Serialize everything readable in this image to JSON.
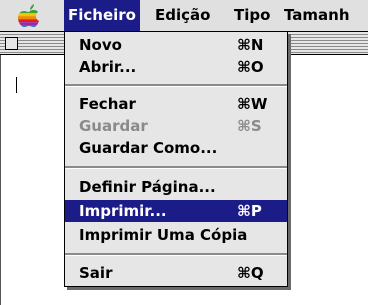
{
  "menubar": {
    "icon": "apple-icon",
    "menus": [
      "Ficheiro",
      "Edição",
      "Tipo",
      "Tamanh"
    ]
  },
  "menu": {
    "items": [
      {
        "label": "Novo",
        "shortcut": "⌘N",
        "enabled": true,
        "selected": false
      },
      {
        "label": "Abrir...",
        "shortcut": "⌘O",
        "enabled": true,
        "selected": false
      },
      {
        "label": "Fechar",
        "shortcut": "⌘W",
        "enabled": true,
        "selected": false
      },
      {
        "label": "Guardar",
        "shortcut": "⌘S",
        "enabled": false,
        "selected": false
      },
      {
        "label": "Guardar Como...",
        "shortcut": "",
        "enabled": true,
        "selected": false
      },
      {
        "label": "Definir Página...",
        "shortcut": "",
        "enabled": true,
        "selected": false
      },
      {
        "label": "Imprimir...",
        "shortcut": "⌘P",
        "enabled": true,
        "selected": true
      },
      {
        "label": "Imprimir Uma Cópia",
        "shortcut": "",
        "enabled": true,
        "selected": false
      },
      {
        "label": "Sair",
        "shortcut": "⌘Q",
        "enabled": true,
        "selected": false
      }
    ]
  },
  "colors": {
    "highlight": "#1c1c88",
    "menu_background": "#e6e6e6",
    "disabled_text": "#8a8a8a"
  }
}
